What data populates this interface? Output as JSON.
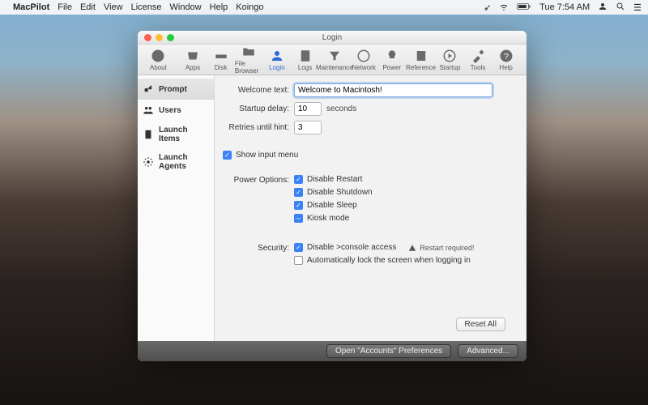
{
  "menubar": {
    "app": "MacPilot",
    "items": [
      "File",
      "Edit",
      "View",
      "License",
      "Window",
      "Help",
      "Koingo"
    ],
    "right": {
      "time": "Tue 7:54 AM"
    }
  },
  "window": {
    "title": "Login",
    "toolbar": [
      {
        "id": "about",
        "label": "About"
      },
      {
        "id": "apps",
        "label": "Apps"
      },
      {
        "id": "disk",
        "label": "Disk"
      },
      {
        "id": "filebrowser",
        "label": "File Browser"
      },
      {
        "id": "login",
        "label": "Login"
      },
      {
        "id": "logs",
        "label": "Logs"
      },
      {
        "id": "maintenance",
        "label": "Maintenance"
      },
      {
        "id": "network",
        "label": "Network"
      },
      {
        "id": "power",
        "label": "Power"
      },
      {
        "id": "reference",
        "label": "Reference"
      },
      {
        "id": "startup",
        "label": "Startup"
      },
      {
        "id": "tools",
        "label": "Tools"
      },
      {
        "id": "help",
        "label": "Help"
      }
    ],
    "sidebar": [
      {
        "id": "prompt",
        "label": "Prompt"
      },
      {
        "id": "users",
        "label": "Users"
      },
      {
        "id": "launchitems",
        "label": "Launch Items"
      },
      {
        "id": "launchagents",
        "label": "Launch Agents"
      }
    ],
    "form": {
      "welcome_label": "Welcome text:",
      "welcome_value": "Welcome to Macintosh!",
      "startup_label": "Startup delay:",
      "startup_value": "10",
      "startup_unit": "seconds",
      "retries_label": "Retries until hint:",
      "retries_value": "3",
      "show_input_menu": "Show input menu",
      "power_label": "Power Options:",
      "power": {
        "restart": "Disable Restart",
        "shutdown": "Disable Shutdown",
        "sleep": "Disable Sleep",
        "kiosk": "Kiosk mode"
      },
      "security_label": "Security:",
      "security": {
        "console": "Disable >console access",
        "autolock": "Automatically lock the screen when logging in"
      },
      "restart_required": "Restart required!",
      "reset": "Reset All"
    },
    "footer": {
      "accounts": "Open \"Accounts\" Preferences",
      "advanced": "Advanced..."
    }
  }
}
